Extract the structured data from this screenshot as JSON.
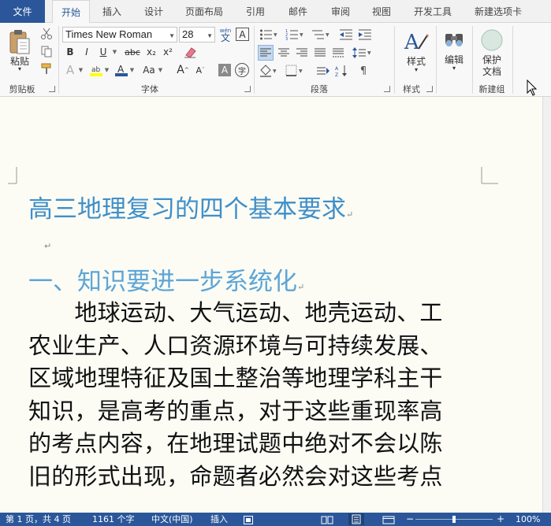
{
  "tabs": {
    "file": "文件",
    "home": "开始",
    "insert": "插入",
    "design": "设计",
    "layout": "页面布局",
    "references": "引用",
    "mailings": "邮件",
    "review": "审阅",
    "view": "视图",
    "developer": "开发工具",
    "new_tab": "新建选项卡"
  },
  "ribbon": {
    "clipboard": {
      "label": "剪贴板",
      "paste": "粘贴"
    },
    "font": {
      "label": "字体",
      "font_name": "Times New Roman",
      "font_size": "28",
      "wen_label": "wén",
      "wen_char": "文",
      "a_box": "A",
      "bold": "B",
      "italic": "I",
      "underline": "U",
      "strike": "abc",
      "sub": "x₂",
      "sup": "x²",
      "aa": "Aa",
      "grow": "A",
      "shrink": "A",
      "shade_a": "A",
      "circle": "字"
    },
    "paragraph": {
      "label": "段落"
    },
    "styles": {
      "label": "样式",
      "button": "样式"
    },
    "editing": {
      "button": "编辑"
    },
    "newgroup": {
      "label": "新建组",
      "protect_line1": "保护",
      "protect_line2": "文档"
    }
  },
  "document": {
    "title": "高三地理复习的四个基本要求",
    "heading": "一、知识要进一步系统化",
    "para_mark": "↵",
    "body_lines": [
      "　　地球运动、大气运动、地壳运动、工",
      "农业生产、人口资源环境与可持续发展、",
      "区域地理特征及国土整治等地理学科主干",
      "知识，是高考的重点，对于这些重现率高",
      "的考点内容，在地理试题中绝对不会以陈",
      "旧的形式出现，命题者必然会对这些考点"
    ]
  },
  "statusbar": {
    "page": "第 1 页，共 4 页",
    "words": "1161 个字",
    "language": "中文(中国)",
    "mode": "插入",
    "zoom": "100%"
  },
  "colors": {
    "brand": "#2b579a",
    "title": "#3f8fc9",
    "heading": "#5da5d6"
  }
}
